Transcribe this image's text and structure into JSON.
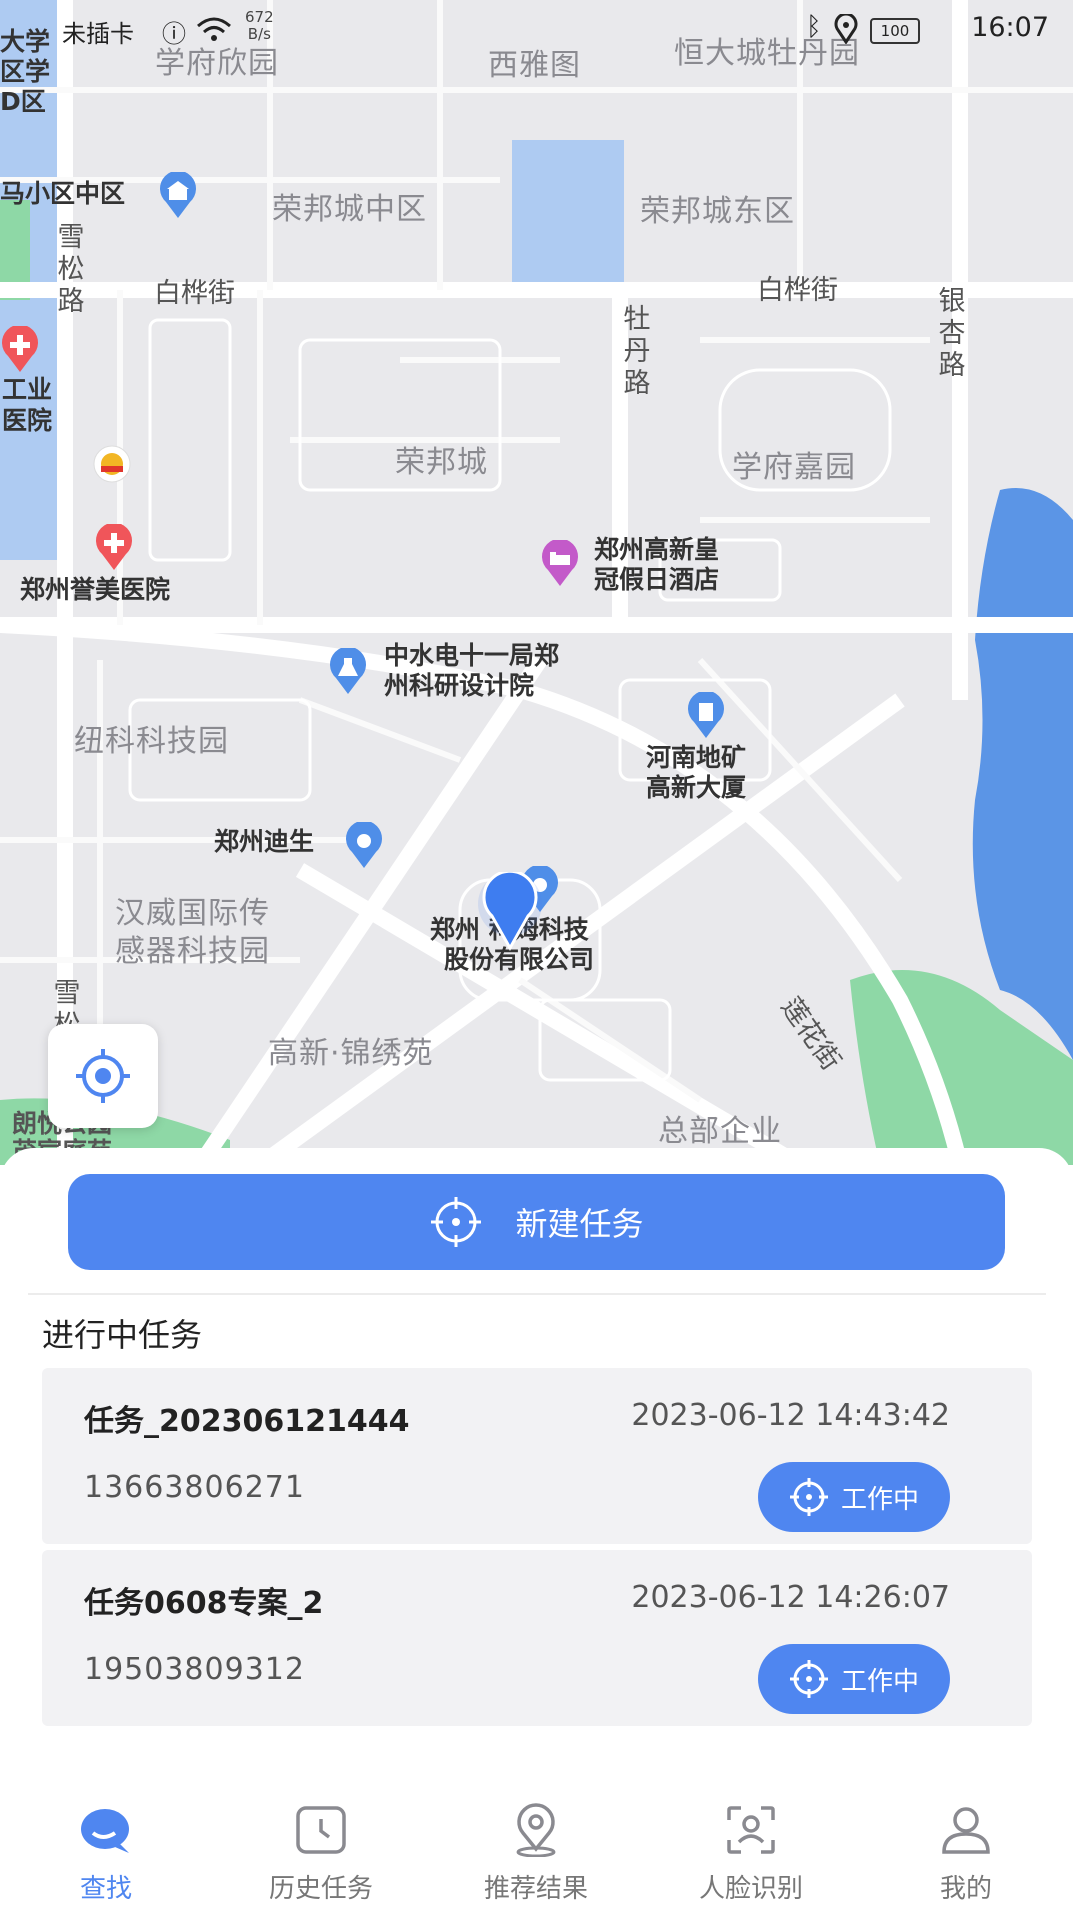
{
  "status_bar": {
    "carrier": "未插卡",
    "net_speed_value": "672",
    "net_speed_unit": "B/s",
    "battery": "100",
    "time": "16:07"
  },
  "map": {
    "areas": {
      "xuefu_xinyuan": "学府欣园",
      "xiyatu": "西雅图",
      "hengda": "恒大城牡丹园",
      "rongbang_zhong": "荣邦城中区",
      "rongbang_dong": "荣邦城东区",
      "rongbang": "荣邦城",
      "xuefu_jiayuan": "学府嘉园",
      "niuke": "纽科科技园",
      "hanwei_line1": "汉威国际传",
      "hanwei_line2": "感器科技园",
      "jinxiu": "高新·锦绣苑",
      "zongbu": "总部企业",
      "univ_line1": "大学",
      "univ_line2": "区学",
      "univ_line3": "D区"
    },
    "roads": {
      "baihua_1": "白桦街",
      "baihua_2": "白桦街",
      "xuesong": "雪松路",
      "xuesong_2": "雪松",
      "mudan": "牡丹路",
      "yinxing": "银杏路",
      "lianhua": "莲花街"
    },
    "pois": {
      "ma_xiaoqu": "马小区中区",
      "gongye_line1": "工业",
      "gongye_line2": "医院",
      "yumei": "郑州誉美医院",
      "hotel_line1": "郑州高新皇",
      "hotel_line2": "冠假日酒店",
      "zhongshui_line1": "中水电十一局郑",
      "zhongshui_line2": "州科研设计院",
      "dikuang_line1": "河南地矿",
      "dikuang_line2": "高新大厦",
      "disheng": "郑州迪生",
      "kemu_line1": "郑州 科姆科技",
      "kemu_line2": "股份有限公司",
      "langyue_line1": "朗悦公园",
      "langyue_line2": "茂宸庭苑"
    }
  },
  "actions": {
    "new_task_label": "新建任务"
  },
  "tasks_section": {
    "title": "进行中任务",
    "items": [
      {
        "name": "任务_202306121444",
        "time": "2023-06-12 14:43:42",
        "phone": "13663806271",
        "status": "工作中"
      },
      {
        "name": "任务0608专案_2",
        "time": "2023-06-12 14:26:07",
        "phone": "19503809312",
        "status": "工作中"
      }
    ]
  },
  "nav": {
    "items": [
      {
        "label": "查找",
        "icon": "search-chat-icon",
        "active": true
      },
      {
        "label": "历史任务",
        "icon": "clock-icon"
      },
      {
        "label": "推荐结果",
        "icon": "location-pin-icon"
      },
      {
        "label": "人脸识别",
        "icon": "face-scan-icon"
      },
      {
        "label": "我的",
        "icon": "user-icon"
      }
    ]
  },
  "colors": {
    "primary": "#4f86f0",
    "map_bg": "#e9e9ec",
    "water": "#7eb2ee",
    "park": "#8ed8a6"
  }
}
